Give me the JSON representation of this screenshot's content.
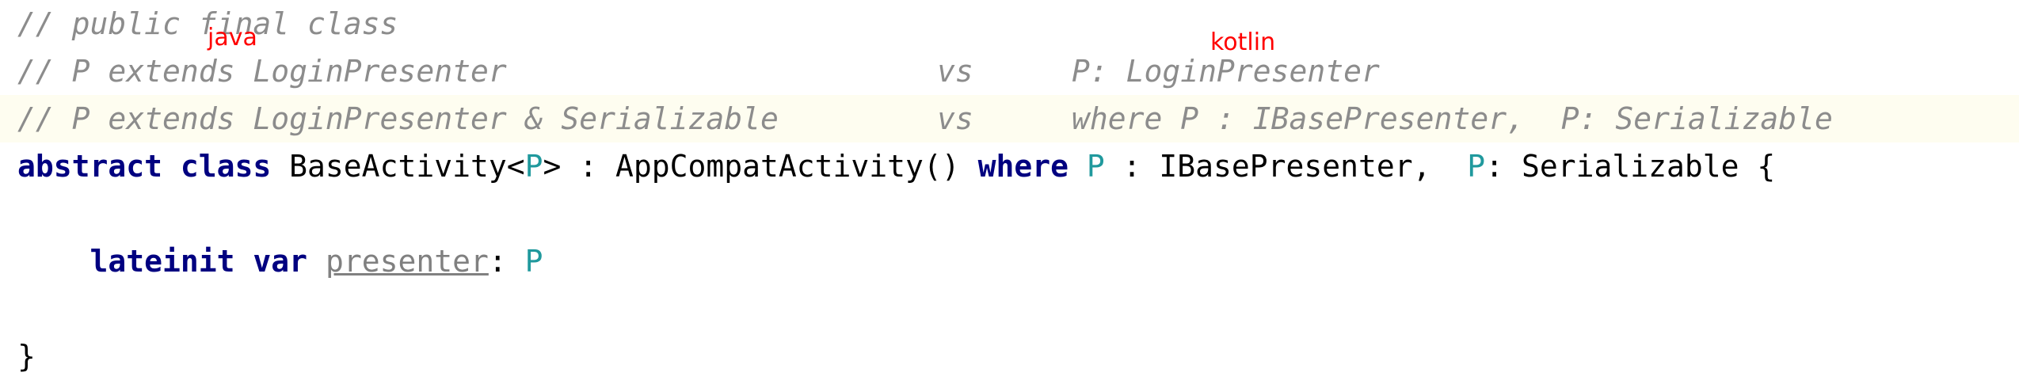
{
  "editor": {
    "lines": {
      "l1": "// public final class",
      "l2": {
        "left": "// P extends LoginPresenter",
        "vs": "vs",
        "right": "P: LoginPresenter"
      },
      "l3": {
        "left": "// P extends LoginPresenter & Serializable",
        "vs": "vs",
        "right": "where P : IBasePresenter,  P: Serializable"
      },
      "l4": {
        "kw1": "abstract class",
        "name": " BaseActivity<",
        "tp1": "P",
        "mid": "> : AppCompatActivity() ",
        "kw2": "where",
        "sp1": " ",
        "tp2": "P",
        "mid2": " : IBasePresenter,  ",
        "tp3": "P",
        "end": ": Serializable {"
      },
      "l6": {
        "indent": "    ",
        "kw": "lateinit var",
        "sp": " ",
        "prop": "presenter",
        "colon": ": ",
        "type": "P"
      },
      "l8": "}"
    }
  },
  "annotations": {
    "java": "java",
    "kotlin": "kotlin"
  },
  "colors": {
    "comment": "#8c8c8c",
    "keyword": "#000080",
    "type_param": "#20999d",
    "annotation": "#ff0000",
    "line_highlight": "#fefdf0"
  }
}
